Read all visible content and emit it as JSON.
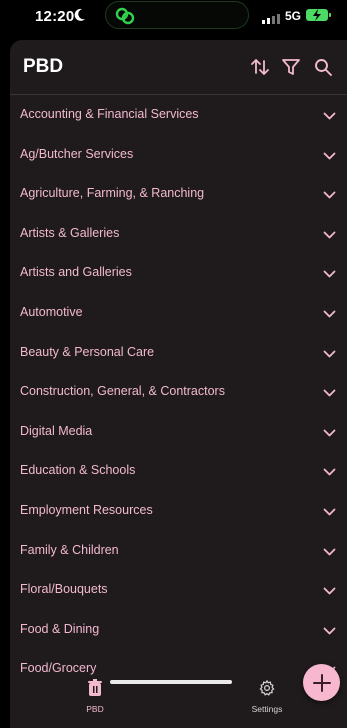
{
  "status": {
    "time": "12:20",
    "network": "5G"
  },
  "header": {
    "title": "PBD"
  },
  "categories": [
    "Accounting & Financial Services",
    "Ag/Butcher Services",
    "Agriculture, Farming, & Ranching",
    "Artists & Galleries",
    "Artists and Galleries",
    "Automotive",
    "Beauty & Personal Care",
    "Construction, General, & Contractors",
    "Digital Media",
    "Education & Schools",
    "Employment Resources",
    "Family & Children",
    "Floral/Bouquets",
    "Food & Dining",
    "Food/Grocery"
  ],
  "tabs": {
    "pbd": "PBD",
    "settings": "Settings"
  },
  "colors": {
    "accent": "#f3b9cf",
    "fab": "#f7b7cf",
    "background": "#1f1b1d",
    "battery": "#4cd964"
  },
  "icons": [
    "moon-icon",
    "link-icon",
    "signal-icon",
    "battery-icon",
    "sort-icon",
    "filter-icon",
    "search-icon",
    "chevron-down-icon",
    "plus-icon",
    "trash-icon",
    "gear-icon"
  ]
}
